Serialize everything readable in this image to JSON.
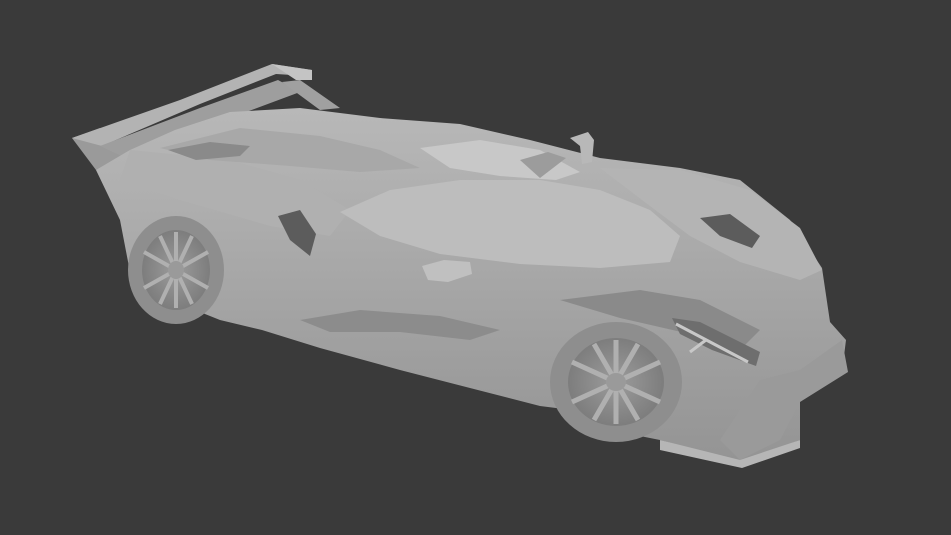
{
  "viewport": {
    "background_color": "#3a3a3a",
    "model": {
      "subject": "hypercar-3d-model",
      "shading": "solid-gray",
      "body_color": "#a4a4a4",
      "highlight_color": "#c4c4c4",
      "shadow_color": "#7e7e7e",
      "dark_color": "#5c5c5c"
    }
  }
}
